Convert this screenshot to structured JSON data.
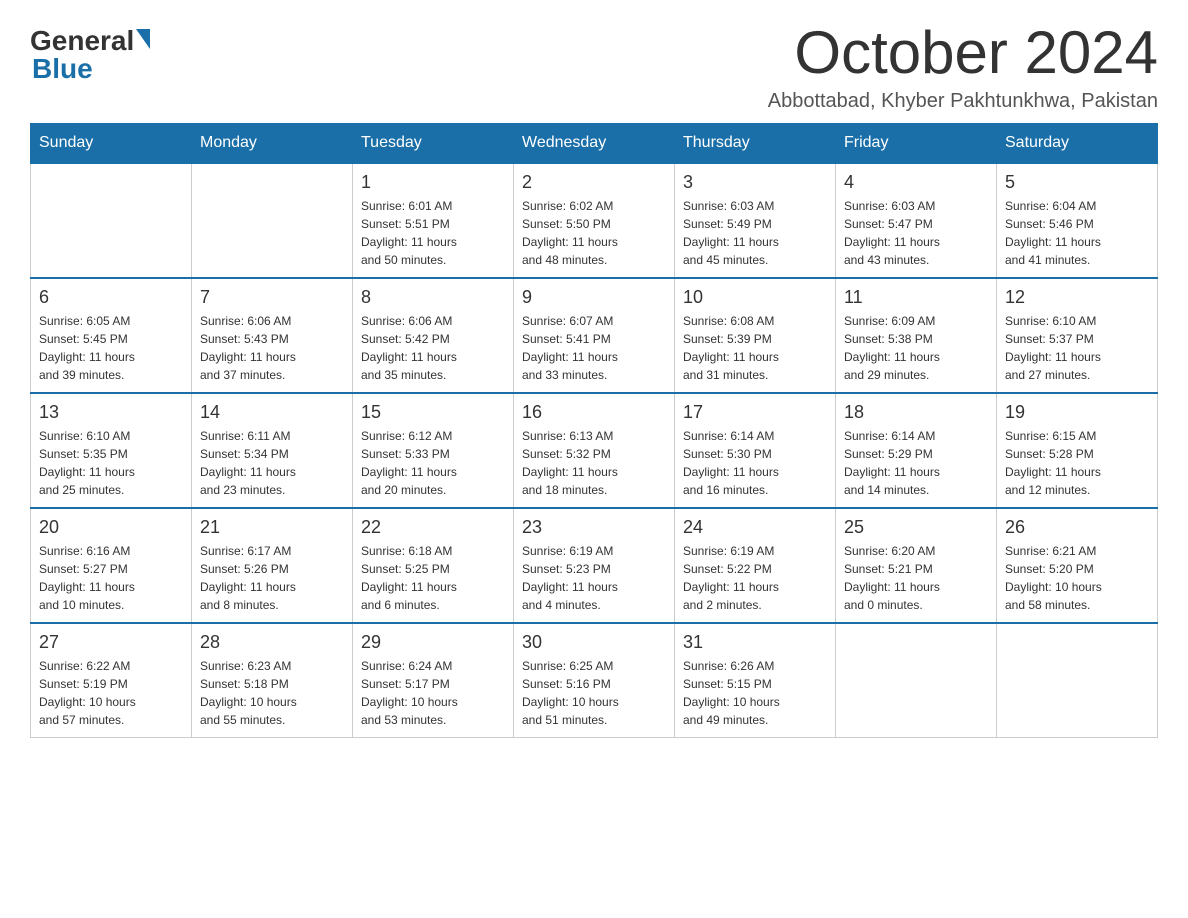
{
  "logo": {
    "general": "General",
    "blue": "Blue"
  },
  "title": "October 2024",
  "location": "Abbottabad, Khyber Pakhtunkhwa, Pakistan",
  "days_of_week": [
    "Sunday",
    "Monday",
    "Tuesday",
    "Wednesday",
    "Thursday",
    "Friday",
    "Saturday"
  ],
  "weeks": [
    [
      {
        "day": "",
        "info": ""
      },
      {
        "day": "",
        "info": ""
      },
      {
        "day": "1",
        "info": "Sunrise: 6:01 AM\nSunset: 5:51 PM\nDaylight: 11 hours\nand 50 minutes."
      },
      {
        "day": "2",
        "info": "Sunrise: 6:02 AM\nSunset: 5:50 PM\nDaylight: 11 hours\nand 48 minutes."
      },
      {
        "day": "3",
        "info": "Sunrise: 6:03 AM\nSunset: 5:49 PM\nDaylight: 11 hours\nand 45 minutes."
      },
      {
        "day": "4",
        "info": "Sunrise: 6:03 AM\nSunset: 5:47 PM\nDaylight: 11 hours\nand 43 minutes."
      },
      {
        "day": "5",
        "info": "Sunrise: 6:04 AM\nSunset: 5:46 PM\nDaylight: 11 hours\nand 41 minutes."
      }
    ],
    [
      {
        "day": "6",
        "info": "Sunrise: 6:05 AM\nSunset: 5:45 PM\nDaylight: 11 hours\nand 39 minutes."
      },
      {
        "day": "7",
        "info": "Sunrise: 6:06 AM\nSunset: 5:43 PM\nDaylight: 11 hours\nand 37 minutes."
      },
      {
        "day": "8",
        "info": "Sunrise: 6:06 AM\nSunset: 5:42 PM\nDaylight: 11 hours\nand 35 minutes."
      },
      {
        "day": "9",
        "info": "Sunrise: 6:07 AM\nSunset: 5:41 PM\nDaylight: 11 hours\nand 33 minutes."
      },
      {
        "day": "10",
        "info": "Sunrise: 6:08 AM\nSunset: 5:39 PM\nDaylight: 11 hours\nand 31 minutes."
      },
      {
        "day": "11",
        "info": "Sunrise: 6:09 AM\nSunset: 5:38 PM\nDaylight: 11 hours\nand 29 minutes."
      },
      {
        "day": "12",
        "info": "Sunrise: 6:10 AM\nSunset: 5:37 PM\nDaylight: 11 hours\nand 27 minutes."
      }
    ],
    [
      {
        "day": "13",
        "info": "Sunrise: 6:10 AM\nSunset: 5:35 PM\nDaylight: 11 hours\nand 25 minutes."
      },
      {
        "day": "14",
        "info": "Sunrise: 6:11 AM\nSunset: 5:34 PM\nDaylight: 11 hours\nand 23 minutes."
      },
      {
        "day": "15",
        "info": "Sunrise: 6:12 AM\nSunset: 5:33 PM\nDaylight: 11 hours\nand 20 minutes."
      },
      {
        "day": "16",
        "info": "Sunrise: 6:13 AM\nSunset: 5:32 PM\nDaylight: 11 hours\nand 18 minutes."
      },
      {
        "day": "17",
        "info": "Sunrise: 6:14 AM\nSunset: 5:30 PM\nDaylight: 11 hours\nand 16 minutes."
      },
      {
        "day": "18",
        "info": "Sunrise: 6:14 AM\nSunset: 5:29 PM\nDaylight: 11 hours\nand 14 minutes."
      },
      {
        "day": "19",
        "info": "Sunrise: 6:15 AM\nSunset: 5:28 PM\nDaylight: 11 hours\nand 12 minutes."
      }
    ],
    [
      {
        "day": "20",
        "info": "Sunrise: 6:16 AM\nSunset: 5:27 PM\nDaylight: 11 hours\nand 10 minutes."
      },
      {
        "day": "21",
        "info": "Sunrise: 6:17 AM\nSunset: 5:26 PM\nDaylight: 11 hours\nand 8 minutes."
      },
      {
        "day": "22",
        "info": "Sunrise: 6:18 AM\nSunset: 5:25 PM\nDaylight: 11 hours\nand 6 minutes."
      },
      {
        "day": "23",
        "info": "Sunrise: 6:19 AM\nSunset: 5:23 PM\nDaylight: 11 hours\nand 4 minutes."
      },
      {
        "day": "24",
        "info": "Sunrise: 6:19 AM\nSunset: 5:22 PM\nDaylight: 11 hours\nand 2 minutes."
      },
      {
        "day": "25",
        "info": "Sunrise: 6:20 AM\nSunset: 5:21 PM\nDaylight: 11 hours\nand 0 minutes."
      },
      {
        "day": "26",
        "info": "Sunrise: 6:21 AM\nSunset: 5:20 PM\nDaylight: 10 hours\nand 58 minutes."
      }
    ],
    [
      {
        "day": "27",
        "info": "Sunrise: 6:22 AM\nSunset: 5:19 PM\nDaylight: 10 hours\nand 57 minutes."
      },
      {
        "day": "28",
        "info": "Sunrise: 6:23 AM\nSunset: 5:18 PM\nDaylight: 10 hours\nand 55 minutes."
      },
      {
        "day": "29",
        "info": "Sunrise: 6:24 AM\nSunset: 5:17 PM\nDaylight: 10 hours\nand 53 minutes."
      },
      {
        "day": "30",
        "info": "Sunrise: 6:25 AM\nSunset: 5:16 PM\nDaylight: 10 hours\nand 51 minutes."
      },
      {
        "day": "31",
        "info": "Sunrise: 6:26 AM\nSunset: 5:15 PM\nDaylight: 10 hours\nand 49 minutes."
      },
      {
        "day": "",
        "info": ""
      },
      {
        "day": "",
        "info": ""
      }
    ]
  ]
}
